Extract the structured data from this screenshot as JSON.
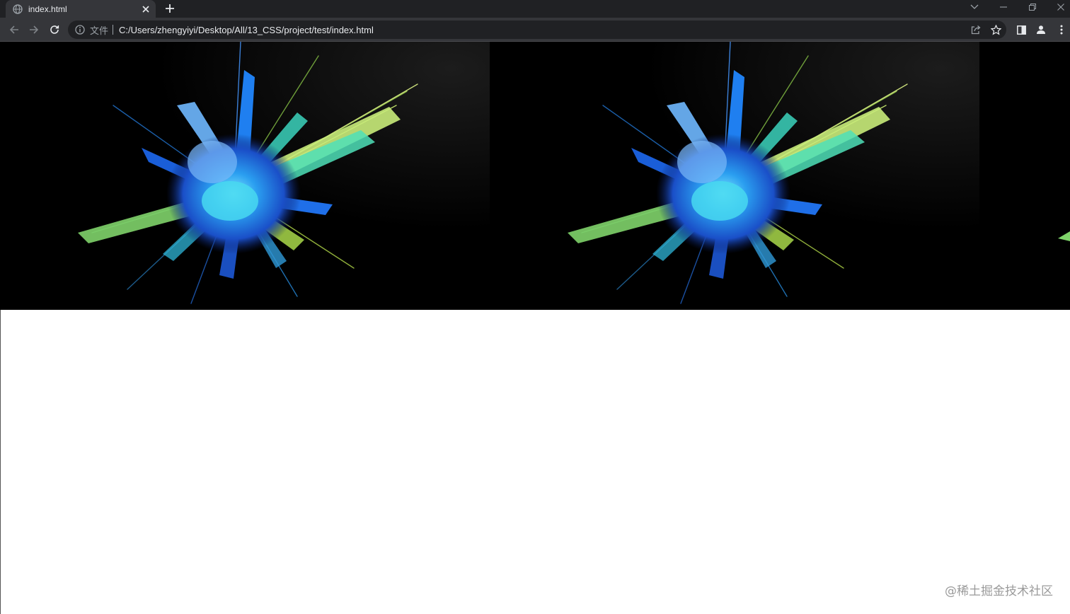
{
  "browser": {
    "tab": {
      "title": "index.html"
    },
    "address": {
      "scheme_label": "文件",
      "url": "C:/Users/zhengyiyi/Desktop/All/13_CSS/project/test/index.html"
    }
  },
  "page": {
    "watermark": "@稀土掘金技术社区"
  },
  "colors": {
    "chrome_dark": "#202124",
    "chrome_toolbar": "#35363a",
    "text_light": "#e8eaed",
    "burst_blue": "#1e6fe0",
    "burst_cyan": "#2fd0e6",
    "burst_green": "#7be35a"
  }
}
